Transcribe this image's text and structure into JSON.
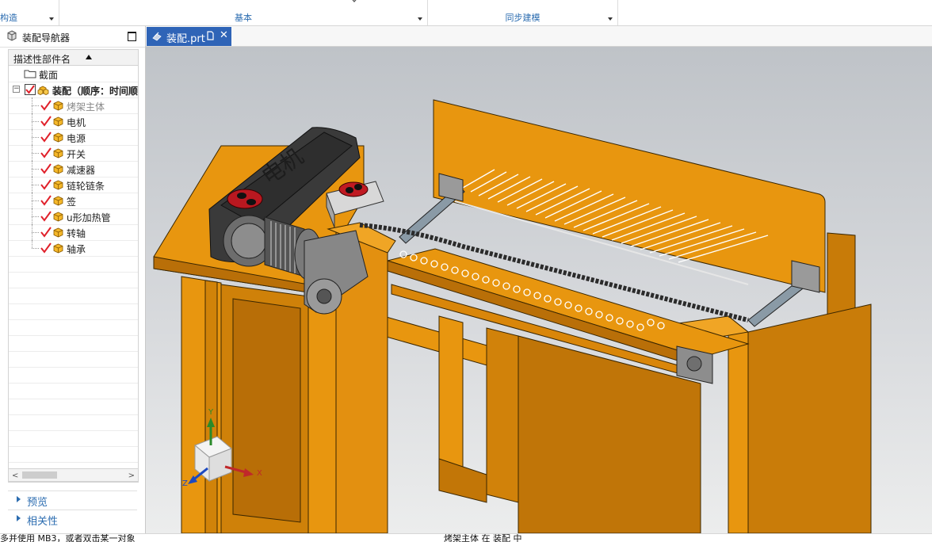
{
  "ribbon": {
    "groups": [
      {
        "label": "构造"
      },
      {
        "label": "基本"
      },
      {
        "label": "同步建模"
      }
    ]
  },
  "navigator": {
    "title": "装配导航器",
    "column_header": "描述性部件名",
    "rows": [
      {
        "label": "截面",
        "type": "folder"
      },
      {
        "label": "装配（顺序：时间顺",
        "type": "assembly"
      },
      {
        "label": "烤架主体",
        "type": "part"
      },
      {
        "label": "电机",
        "type": "part"
      },
      {
        "label": "电源",
        "type": "part"
      },
      {
        "label": "开关",
        "type": "part"
      },
      {
        "label": "减速器",
        "type": "part"
      },
      {
        "label": "链轮链条",
        "type": "part"
      },
      {
        "label": "签",
        "type": "part"
      },
      {
        "label": "u形加热管",
        "type": "part"
      },
      {
        "label": "转轴",
        "type": "part"
      },
      {
        "label": "轴承",
        "type": "part"
      }
    ],
    "sections": [
      {
        "label": "预览"
      },
      {
        "label": "相关性"
      }
    ]
  },
  "document_tab": {
    "label": "装配.prt",
    "close": "✕"
  },
  "triad": {
    "x": "X",
    "y": "Y",
    "z": "Z"
  },
  "status": {
    "left": "多并使用 MB3，或者双击某一对象",
    "center": "烤架主体 在 装配 中"
  },
  "colors": {
    "accent": "#2f64b7",
    "frame_orange": "#e8960f",
    "frame_shadow": "#b96f08",
    "motor": "#3a3a3a",
    "check_red": "#e0202a"
  },
  "icons": {
    "navigator": "assembly-navigator-icon",
    "tab": "part-file-icon",
    "folder": "folder-icon",
    "part": "component-cube-icon",
    "check": "checkmark-icon"
  }
}
